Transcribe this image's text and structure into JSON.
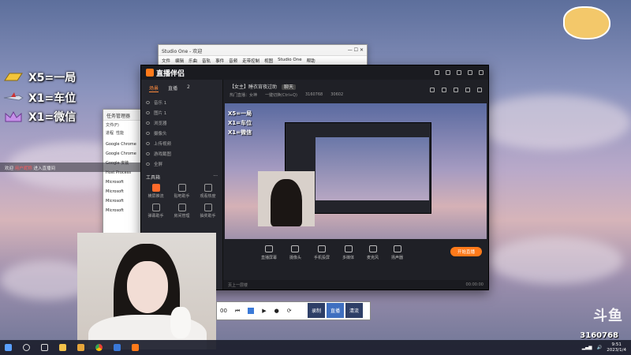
{
  "overlay": {
    "labels": [
      {
        "text": "X5=一局",
        "color": "#f3c53b",
        "icon": "gold-bar-icon"
      },
      {
        "text": "X1=车位",
        "color": "#b8c4d8",
        "icon": "airplane-icon"
      },
      {
        "text": "X1=微信",
        "color": "#c58fe8",
        "icon": "crown-icon"
      }
    ]
  },
  "studio_window": {
    "title": "Studio One - 欢迎",
    "menu": [
      "文件",
      "编辑",
      "乐曲",
      "音轨",
      "事件",
      "音频",
      "走带控制",
      "视图",
      "Studio One",
      "帮助"
    ]
  },
  "task_manager": {
    "title": "任务管理器",
    "menu": [
      "文件(F)",
      "选项(O)",
      "查看(V)"
    ],
    "tabs": [
      "进程",
      "性能",
      "应用历史记录"
    ],
    "rows": [
      "Google Chrome",
      "Google Chrome",
      "Google 安装",
      "Host Process",
      "Microsoft",
      "Microsoft",
      "Microsoft",
      "Microsoft"
    ]
  },
  "app": {
    "logo": "直播伴侣",
    "tabs": [
      "场景",
      "直播",
      "2"
    ],
    "sources": [
      "音乐 1",
      "图片 1",
      "浏览器",
      "摄像头",
      "上传视频",
      "游戏截图",
      "全屏"
    ],
    "tools_title": "工具箱",
    "tools": [
      "横屏推流",
      "贴吧助手",
      "观看热度",
      "弹幕助手",
      "房间管理",
      "抽奖助手"
    ],
    "room_title": "【女主】睡衣宵夜过助",
    "room_tag": "聊天",
    "room_sub": [
      "热门直播：女神",
      "一键切换(Ctrl+Q)",
      "3160768",
      "30602"
    ],
    "preview_labels": [
      "X5=一局",
      "X1=车位",
      "X1=微信"
    ],
    "bottom_tools": [
      "直播屏幕",
      "摄像头",
      "手机投屏",
      "多媒体",
      "麦克风",
      "扬声器"
    ],
    "live_button": "开始直播",
    "status_left": "页上一层楼",
    "status_right": "00:00:00"
  },
  "player": {
    "time": "00",
    "buttons": [
      "录制",
      "直播",
      "清流"
    ]
  },
  "chat": {
    "prefix": "欢迎",
    "name": "用户昵称",
    "text": "进入直播间"
  },
  "watermark": {
    "brand": "斗鱼",
    "room_id": "3160768",
    "date": "2023/1/4"
  },
  "taskbar": {
    "time": "9:51",
    "date": "2023/1/4"
  }
}
